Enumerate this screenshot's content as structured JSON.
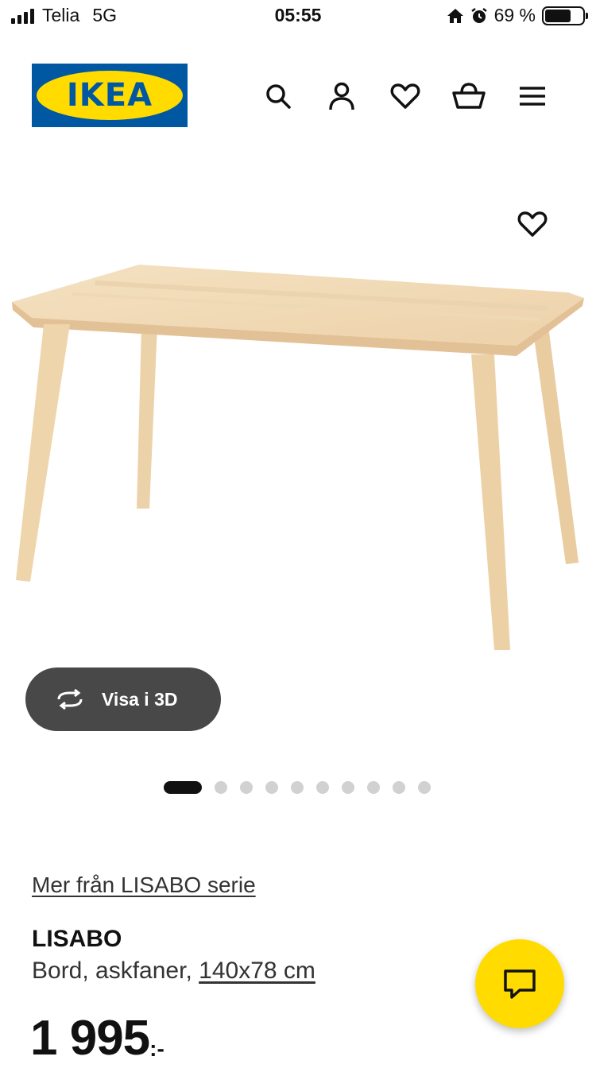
{
  "status_bar": {
    "carrier": "Telia",
    "network": "5G",
    "time": "05:55",
    "battery_text": "69 %",
    "battery_level": 0.69
  },
  "header": {
    "logo_text": "IKEA",
    "logo_mark": "®",
    "icons": [
      "search-icon",
      "user-icon",
      "heart-icon",
      "basket-icon",
      "menu-icon"
    ]
  },
  "gallery": {
    "view_3d_label": "Visa i 3D",
    "slide_count": 10,
    "active_slide": 1
  },
  "product": {
    "series_link": "Mer från LISABO serie",
    "name": "LISABO",
    "description": "Bord, askfaner,",
    "size": "140x78 cm",
    "price": "1 995",
    "price_suffix": ":-"
  },
  "colors": {
    "ikea_blue": "#0058a3",
    "ikea_yellow": "#ffdb00",
    "pill": "#484848"
  }
}
